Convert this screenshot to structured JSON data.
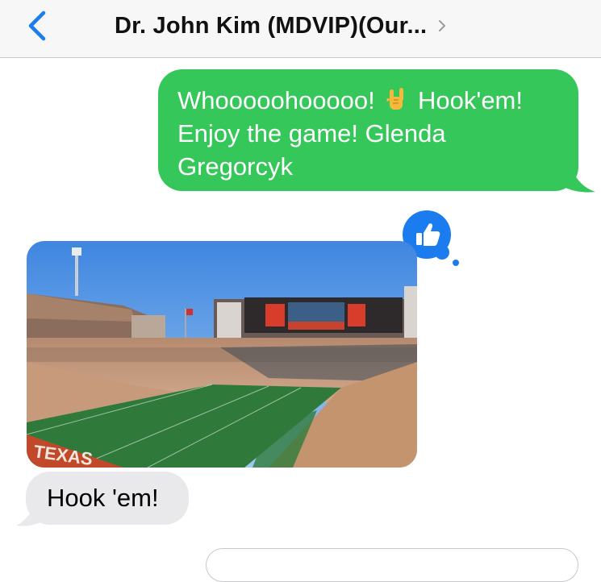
{
  "header": {
    "title": "Dr. John Kim (MDVIP)(Our...",
    "back_icon": "chevron-left-icon",
    "detail_icon": "chevron-right-icon"
  },
  "messages": [
    {
      "type": "sent",
      "text_part1": "Whoooooh",
      "text_part2": "ooooo!",
      "emoji": "sign-of-horns",
      "text_part3": " Hook'em! Enjoy the game! Glenda Gregorcyk"
    },
    {
      "type": "received-image",
      "description": "stadium photo"
    },
    {
      "type": "received",
      "text": "Hook 'em!"
    }
  ],
  "tapback": {
    "icon": "thumbs-up-icon"
  },
  "colors": {
    "sent_bubble": "#35c759",
    "received_bubble": "#e9e9eb",
    "accent": "#1b7cf0"
  }
}
